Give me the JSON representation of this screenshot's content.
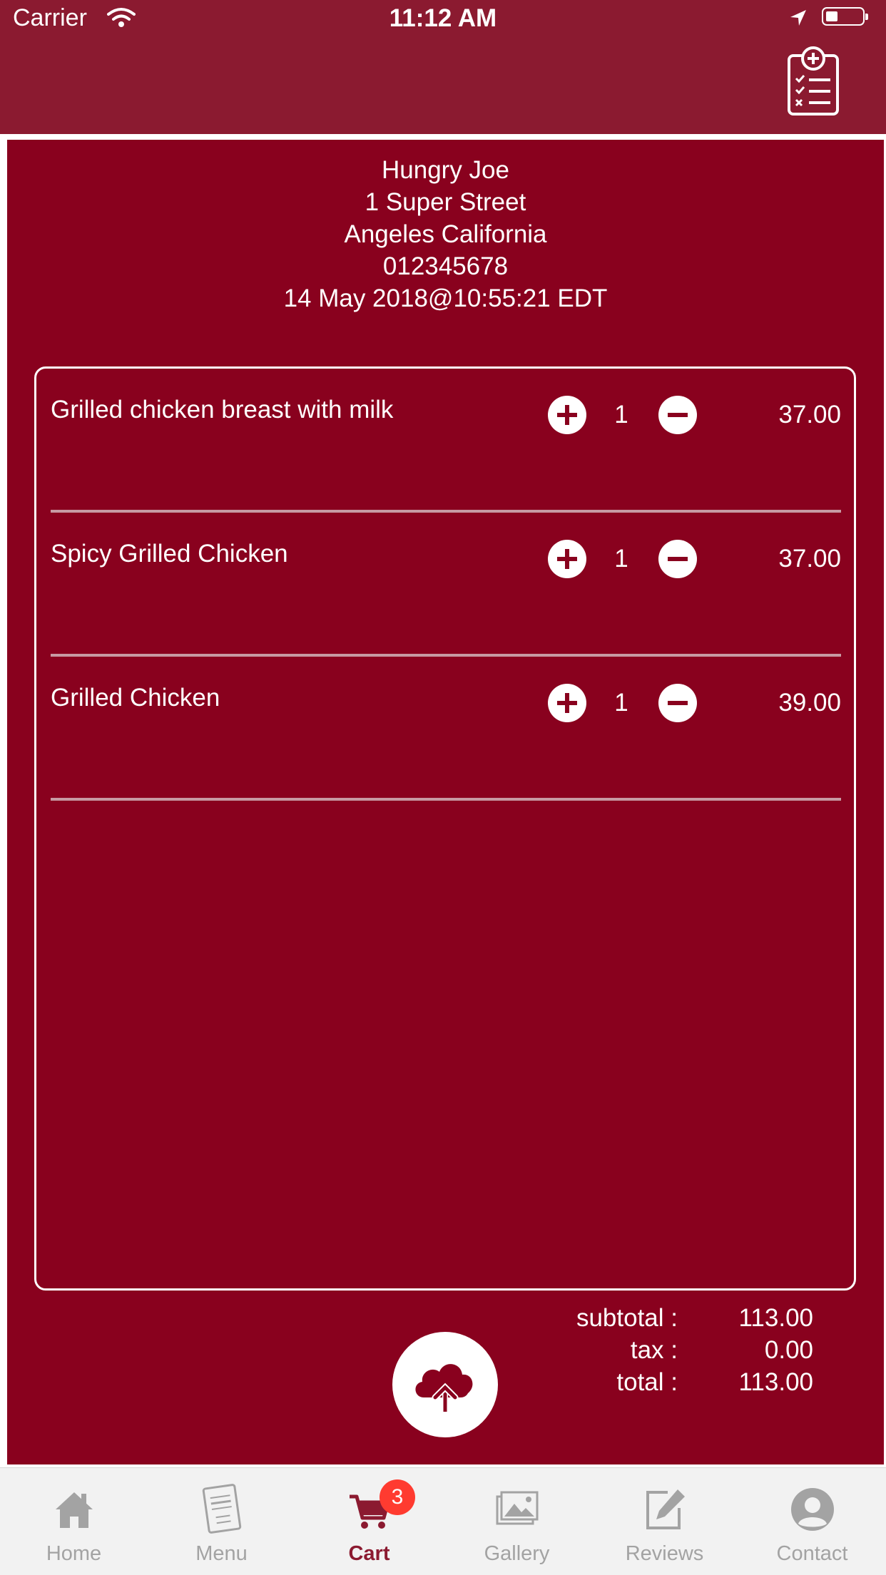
{
  "status_bar": {
    "carrier": "Carrier",
    "time": "11:12 AM"
  },
  "colors": {
    "header": "#8b1a30",
    "background": "#89011e",
    "active_tab": "#8b1a30",
    "inactive_tab": "#a3a3a3",
    "badge": "#ff3b30"
  },
  "header": {
    "action_icon": "clipboard-add-icon"
  },
  "restaurant": {
    "name": "Hungry Joe",
    "street": "1 Super Street",
    "city": "Angeles California",
    "phone": "012345678",
    "timestamp": "14 May 2018@10:55:21 EDT"
  },
  "cart": {
    "items": [
      {
        "name": "Grilled chicken breast with milk",
        "qty": "1",
        "price": "37.00"
      },
      {
        "name": "Spicy Grilled Chicken",
        "qty": "1",
        "price": "37.00"
      },
      {
        "name": "Grilled Chicken",
        "qty": "1",
        "price": "39.00"
      }
    ]
  },
  "totals": {
    "subtotal_label": "subtotal :",
    "subtotal": "113.00",
    "tax_label": "tax :",
    "tax": "0.00",
    "total_label": "total :",
    "total": "113.00"
  },
  "upload_icon": "cloud-upload-icon",
  "tabs": [
    {
      "label": "Home",
      "icon": "home-icon"
    },
    {
      "label": "Menu",
      "icon": "menu-card-icon"
    },
    {
      "label": "Cart",
      "icon": "cart-icon",
      "badge": "3",
      "active": true
    },
    {
      "label": "Gallery",
      "icon": "gallery-icon"
    },
    {
      "label": "Reviews",
      "icon": "edit-icon"
    },
    {
      "label": "Contact",
      "icon": "user-icon"
    }
  ]
}
